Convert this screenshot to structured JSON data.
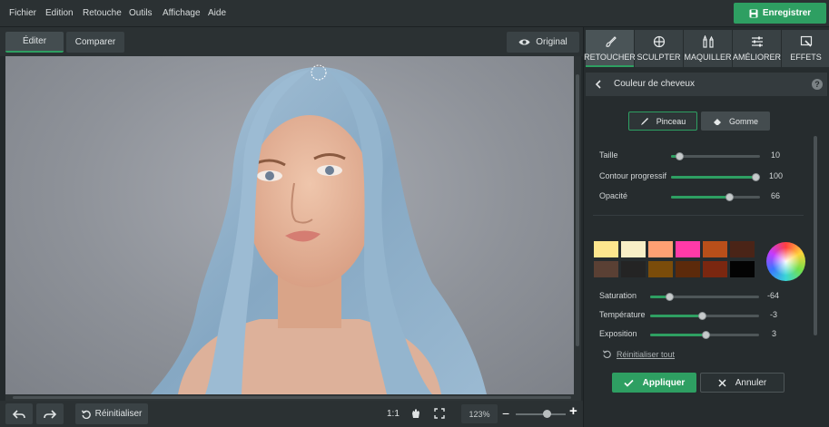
{
  "menu": {
    "items": [
      "Fichier",
      "Edition",
      "Retouche",
      "Outils",
      "Affichage",
      "Aide"
    ],
    "save_label": "Enregistrer"
  },
  "toolbar": {
    "edit_label": "Éditer",
    "compare_label": "Comparer",
    "original_label": "Original"
  },
  "tabs": [
    {
      "label": "RETOUCHER",
      "icon": "brush-retouch-icon",
      "active": true
    },
    {
      "label": "SCULPTER",
      "icon": "crosshair-icon",
      "active": false
    },
    {
      "label": "MAQUILLER",
      "icon": "makeup-icon",
      "active": false
    },
    {
      "label": "AMÉLIORER",
      "icon": "sliders-icon",
      "active": false
    },
    {
      "label": "EFFETS",
      "icon": "magic-wand-icon",
      "active": false
    }
  ],
  "panel": {
    "title": "Couleur de cheveux",
    "help": "?",
    "brush_label": "Pinceau",
    "eraser_label": "Gomme",
    "brush_sliders": [
      {
        "label": "Taille",
        "value": "10",
        "fraction": 0.1
      },
      {
        "label": "Contour progressif",
        "value": "100",
        "fraction": 1.0
      },
      {
        "label": "Opacité",
        "value": "66",
        "fraction": 0.66
      }
    ],
    "swatches": [
      "#fde68e",
      "#f8efc6",
      "#fea073",
      "#ff3aa8",
      "#b84f1a",
      "#4a2417",
      "#5a4034",
      "#242424",
      "#7a4c0a",
      "#5c2a0b",
      "#7a2710",
      "#030303"
    ],
    "color_sliders": [
      {
        "label": "Saturation",
        "value": "-64",
        "fraction": 0.18
      },
      {
        "label": "Température",
        "value": "-3",
        "fraction": 0.485
      },
      {
        "label": "Exposition",
        "value": "3",
        "fraction": 0.515
      }
    ],
    "reset_all": "Réinitialiser tout",
    "apply_label": "Appliquer",
    "cancel_label": "Annuler"
  },
  "bottom": {
    "reset_label": "Réinitialiser",
    "ratio": "1:1",
    "zoom": "123%",
    "zoom_fraction": 0.62
  },
  "colors": {
    "accent": "#2e9f62",
    "hair": "#8fb1cc"
  }
}
